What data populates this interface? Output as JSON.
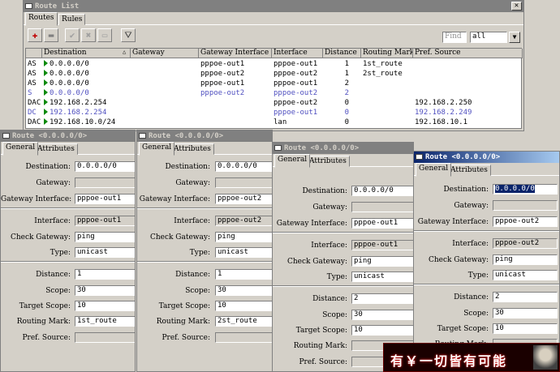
{
  "route_list": {
    "title": "Route List",
    "tabs": [
      "Routes",
      "Rules"
    ],
    "find_placeholder": "Find",
    "filter_value": "all",
    "columns": [
      "Destination",
      "Gateway",
      "Gateway Interface",
      "Interface",
      "Distance",
      "Routing Mark",
      "Pref. Source"
    ],
    "rows": [
      {
        "flags": "AS",
        "dest": "0.0.0.0/0",
        "gateway": "",
        "gw_iface": "pppoe-out1",
        "iface": "pppoe-out1",
        "distance": "1",
        "mark": "1st_route",
        "src": ""
      },
      {
        "flags": "AS",
        "dest": "0.0.0.0/0",
        "gateway": "",
        "gw_iface": "pppoe-out2",
        "iface": "pppoe-out2",
        "distance": "1",
        "mark": "2st_route",
        "src": ""
      },
      {
        "flags": "AS",
        "dest": "0.0.0.0/0",
        "gateway": "",
        "gw_iface": "pppoe-out1",
        "iface": "pppoe-out1",
        "distance": "2",
        "mark": "",
        "src": ""
      },
      {
        "flags": "S",
        "dest": "0.0.0.0/0",
        "gateway": "",
        "gw_iface": "pppoe-out2",
        "iface": "pppoe-out2",
        "distance": "2",
        "mark": "",
        "src": ""
      },
      {
        "flags": "DAC",
        "dest": "192.168.2.254",
        "gateway": "",
        "gw_iface": "",
        "iface": "pppoe-out2",
        "distance": "0",
        "mark": "",
        "src": "192.168.2.250"
      },
      {
        "flags": "DC",
        "dest": "192.168.2.254",
        "gateway": "",
        "gw_iface": "",
        "iface": "pppoe-out1",
        "distance": "0",
        "mark": "",
        "src": "192.168.2.249"
      },
      {
        "flags": "DAC",
        "dest": "192.168.10.0/24",
        "gateway": "",
        "gw_iface": "",
        "iface": "lan",
        "distance": "0",
        "mark": "",
        "src": "192.168.10.1"
      }
    ]
  },
  "labels": {
    "destination": "Destination:",
    "gateway": "Gateway:",
    "gateway_interface": "Gateway Interface:",
    "interface": "Interface:",
    "check_gateway": "Check Gateway:",
    "type": "Type:",
    "distance": "Distance:",
    "scope": "Scope:",
    "target_scope": "Target Scope:",
    "routing_mark": "Routing Mark:",
    "pref_source": "Pref. Source:"
  },
  "route_windows": [
    {
      "title": "Route <0.0.0.0/0>",
      "tabs": [
        "General",
        "Attributes"
      ],
      "destination": "0.0.0.0/0",
      "gateway": "",
      "gateway_interface": "pppoe-out1",
      "interface": "pppoe-out1",
      "check_gateway": "ping",
      "type": "unicast",
      "distance": "1",
      "scope": "30",
      "target_scope": "10",
      "routing_mark": "1st_route",
      "pref_source": ""
    },
    {
      "title": "Route <0.0.0.0/0>",
      "tabs": [
        "General",
        "Attributes"
      ],
      "destination": "0.0.0.0/0",
      "gateway": "",
      "gateway_interface": "pppoe-out2",
      "interface": "pppoe-out2",
      "check_gateway": "ping",
      "type": "unicast",
      "distance": "1",
      "scope": "30",
      "target_scope": "10",
      "routing_mark": "2st_route",
      "pref_source": ""
    },
    {
      "title": "Route <0.0.0.0/0>",
      "tabs": [
        "General",
        "Attributes"
      ],
      "destination": "0.0.0.0/0",
      "gateway": "",
      "gateway_interface": "pppoe-out1",
      "interface": "pppoe-out1",
      "check_gateway": "ping",
      "type": "unicast",
      "distance": "2",
      "scope": "30",
      "target_scope": "10",
      "routing_mark": "",
      "pref_source": ""
    },
    {
      "title": "Route <0.0.0.0/0>",
      "tabs": [
        "General",
        "Attributes"
      ],
      "destination": "0.0.0.0/0",
      "gateway": "",
      "gateway_interface": "pppoe-out2",
      "interface": "pppoe-out2",
      "check_gateway": "ping",
      "type": "unicast",
      "distance": "2",
      "scope": "30",
      "target_scope": "10",
      "routing_mark": "",
      "pref_source": ""
    }
  ],
  "watermark": {
    "text": "有￥一切皆有可能"
  }
}
